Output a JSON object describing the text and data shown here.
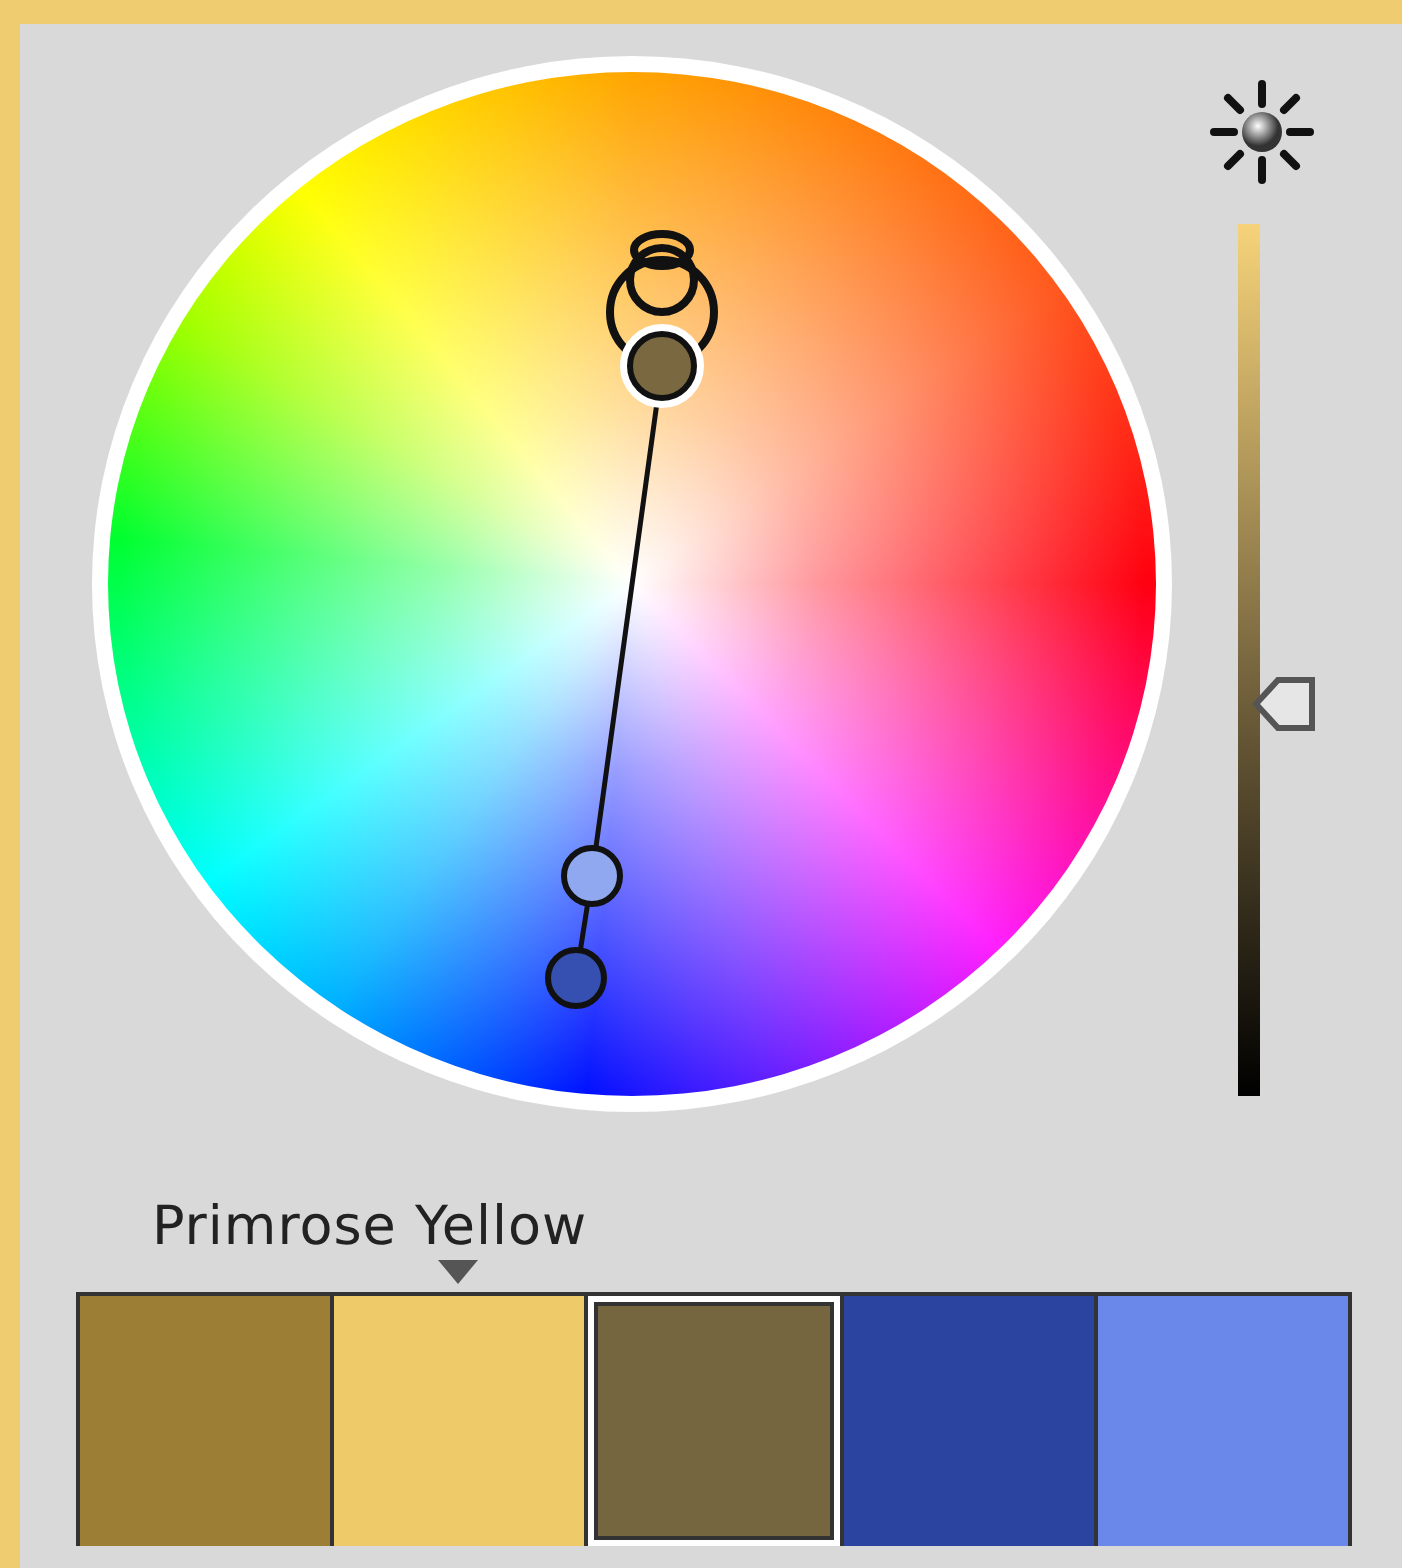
{
  "wheel_handles": [
    {
      "color": "#7a6840",
      "selected": true
    },
    {
      "color": "#8fa8f0",
      "selected": false
    },
    {
      "color": "#3550b0",
      "selected": false
    }
  ],
  "brightness": {
    "level": 0.45
  },
  "color_name": "Primrose Yellow",
  "swatches": [
    {
      "color": "#9c7f35",
      "selected": false,
      "pointed": false
    },
    {
      "color": "#efca68",
      "selected": false,
      "pointed": true
    },
    {
      "color": "#766640",
      "selected": true,
      "pointed": false
    },
    {
      "color": "#2a44a0",
      "selected": false,
      "pointed": false
    },
    {
      "color": "#6a88ea",
      "selected": false,
      "pointed": false
    }
  ]
}
